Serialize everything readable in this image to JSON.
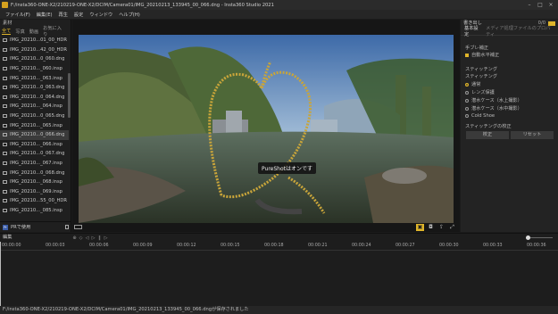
{
  "window": {
    "title": "F:/insta360-ONE-X2/210219-ONE-X2/DCIM/Camera01/IMG_20210213_133945_00_066.dng - Insta360 Studio 2021"
  },
  "menu": [
    "ファイル(F)",
    "編集(E)",
    "再生",
    "設定",
    "ウィンドウ",
    "ヘルプ(H)"
  ],
  "library": {
    "title": "素材",
    "tabs": [
      "全て",
      "写真",
      "動画",
      "お気に入り"
    ],
    "files": [
      "IMG_20210...01_00_HDR",
      "IMG_20210...42_00_HDR",
      "IMG_20210...0_060.dng",
      "IMG_20210..._060.insp",
      "IMG_20210..._063.insp",
      "IMG_20210...0_063.dng",
      "IMG_20210...0_064.dng",
      "IMG_20210..._064.insp",
      "IMG_20210...0_065.dng",
      "IMG_20210..._065.insp",
      "IMG_20210...0_066.dng",
      "IMG_20210..._066.insp",
      "IMG_20210...0_067.dng",
      "IMG_20210..._067.insp",
      "IMG_20210...0_068.dng",
      "IMG_20210..._068.insp",
      "IMG_20210..._069.insp",
      "IMG_20210...55_00_HDR",
      "IMG_20210..._085.insp"
    ],
    "selected_index": 10,
    "bottom_label": "PRで使用"
  },
  "preview": {
    "tooltip": "PureShotはオンです"
  },
  "right_panel": {
    "title": "書き出し",
    "count": "0/0",
    "tabs": [
      "基本設定",
      "メディア処理ファイルのプロパティ"
    ],
    "stabilization_title": "手ブレ補正",
    "auto_level": "自動水平補正",
    "stitching_title": "スティッチング",
    "stitching_sub": "スティッチング",
    "options": [
      "通常",
      "レンズ保護",
      "潜水ケース（水上撮影）",
      "潜水ケース（水中撮影）",
      "Cold Shoe"
    ],
    "selected_option": 0,
    "calib_title": "スティッチングの校正",
    "calib_btn": "校正",
    "reset_btn": "リセット"
  },
  "timeline": {
    "title": "編集",
    "ticks": [
      "00:00:00",
      "00:00:03",
      "00:00:06",
      "00:00:09",
      "00:00:12",
      "00:00:15",
      "00:00:18",
      "00:00:21",
      "00:00:24",
      "00:00:27",
      "00:00:30",
      "00:00:33",
      "00:00:36"
    ]
  },
  "status": {
    "message": "F:/insta360-ONE-X2/210219-ONE-X2/DCIM/Camera01/IMG_20210213_133945_00_066.dngが保存されました"
  },
  "colors": {
    "accent": "#e0b52a",
    "panel": "#1f1f1f",
    "bg": "#1b1b1b"
  }
}
